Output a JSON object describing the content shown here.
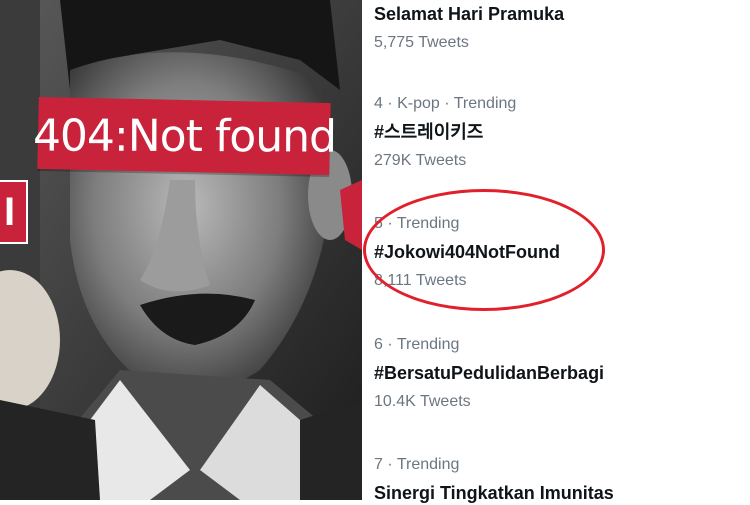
{
  "mural": {
    "banner_text": "404:Not found",
    "side_letter": "I",
    "colors": {
      "banner": "#c8233a",
      "background": "#2a2a2a"
    }
  },
  "trends": [
    {
      "meta": "",
      "name": "Selamat Hari Pramuka",
      "count": "5,775 Tweets"
    },
    {
      "meta": "4 · K-pop · Trending",
      "name": "#스트레이키즈",
      "count": "279K Tweets"
    },
    {
      "meta": "5 · Trending",
      "name": "#Jokowi404NotFound",
      "count": "8,111 Tweets",
      "highlighted": true
    },
    {
      "meta": "6 · Trending",
      "name": "#BersatuPedulidanBerbagi",
      "count": "10.4K Tweets"
    },
    {
      "meta": "7 · Trending",
      "name": "Sinergi Tingkatkan Imunitas",
      "count": ""
    }
  ],
  "colors": {
    "accent_circle": "#e2202c",
    "meta_text": "#6b7681",
    "name_text": "#0f1419"
  }
}
